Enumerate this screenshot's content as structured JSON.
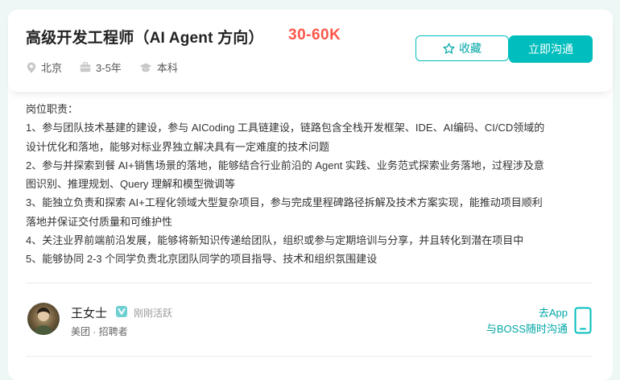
{
  "job": {
    "title": "高级开发工程师（AI Agent 方向）",
    "salary": "30-60K",
    "location": "北京",
    "experience": "3-5年",
    "education": "本科"
  },
  "actions": {
    "favorite_label": "收藏",
    "chat_label": "立即沟通"
  },
  "description": {
    "heading": "岗位职责：",
    "items": [
      "1、参与团队技术基建的建设，参与 AICoding 工具链建设，链路包含全栈开发框架、IDE、AI编码、CI/CD领域的",
      "设计优化和落地，能够对标业界独立解决具有一定难度的技术问题",
      "2、参与并探索到餐 AI+销售场景的落地，能够结合行业前沿的 Agent 实践、业务范式探索业务落地，过程涉及意",
      "图识别、推理规划、Query 理解和模型微调等",
      "3、能独立负责和探索 AI+工程化领域大型复杂项目，参与完成里程碑路径拆解及技术方案实现，能推动项目顺利",
      "落地并保证交付质量和可维护性",
      "4、关注业界前端前沿发展，能够将新知识传递给团队，组织或参与定期培训与分享，并且转化到潜在项目中",
      "5、能够协同 2-3 个同学负责北京团队同学的项目指导、技术和组织氛围建设"
    ]
  },
  "recruiter": {
    "name": "王女士",
    "status": "刚刚活跃",
    "company_role": "美团 · 招聘者"
  },
  "app_prompt": {
    "line1": "去App",
    "line2": "与BOSS随时沟通"
  },
  "colors": {
    "accent": "#00bebd",
    "salary": "#fe574a",
    "background": "#eef6f6"
  },
  "icons": [
    "location-icon",
    "briefcase-icon",
    "graduation-cap-icon",
    "star-icon",
    "verified-icon",
    "phone-icon"
  ]
}
